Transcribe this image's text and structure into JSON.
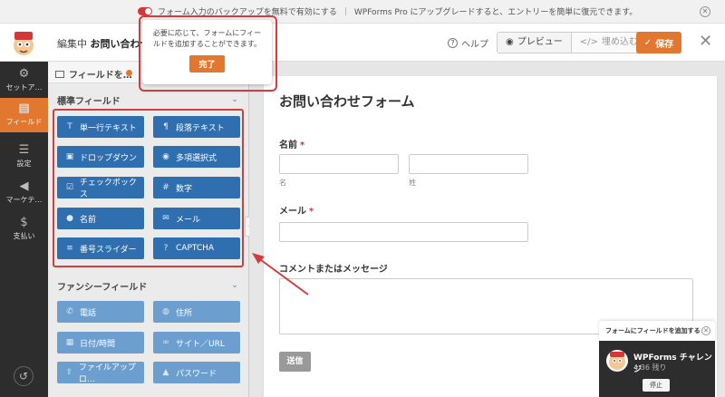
{
  "notice": {
    "text": "フォーム入力のバックアップを無料で有効にする",
    "upgrade": "WPForms Pro にアップグレードすると、エントリーを簡単に復元できます。"
  },
  "header": {
    "editing_prefix": "編集中",
    "form_name": "お問い合わせフォ",
    "help": "ヘルプ",
    "preview": "プレビュー",
    "embed": "埋め込む",
    "save": "保存"
  },
  "leftnav": [
    {
      "label": "セットア…",
      "icon": "gear-icon"
    },
    {
      "label": "フィールド",
      "icon": "fields-icon"
    },
    {
      "label": "設定",
      "icon": "sliders-icon"
    },
    {
      "label": "マーケテ…",
      "icon": "megaphone-icon"
    },
    {
      "label": "支払い",
      "icon": "dollar-icon"
    }
  ],
  "panel": {
    "tab_label": "フィールドを…",
    "standard_title": "標準フィールド",
    "fancy_title": "ファンシーフィールド",
    "standard_fields": [
      {
        "label": "単一行テキスト",
        "icon": "text-icon"
      },
      {
        "label": "段落テキスト",
        "icon": "paragraph-icon"
      },
      {
        "label": "ドロップダウン",
        "icon": "dropdown-icon"
      },
      {
        "label": "多項選択式",
        "icon": "radio-icon"
      },
      {
        "label": "チェックボックス",
        "icon": "checkbox-icon"
      },
      {
        "label": "数字",
        "icon": "hash-icon"
      },
      {
        "label": "名前",
        "icon": "user-icon"
      },
      {
        "label": "メール",
        "icon": "envelope-icon"
      },
      {
        "label": "番号スライダー",
        "icon": "slider-icon"
      },
      {
        "label": "CAPTCHA",
        "icon": "question-icon"
      }
    ],
    "fancy_fields": [
      {
        "label": "電話",
        "icon": "phone-icon"
      },
      {
        "label": "住所",
        "icon": "map-pin-icon"
      },
      {
        "label": "日付/時間",
        "icon": "calendar-icon"
      },
      {
        "label": "サイト／URL",
        "icon": "link-icon"
      },
      {
        "label": "ファイルアップロ…",
        "icon": "upload-icon"
      },
      {
        "label": "パスワード",
        "icon": "lock-icon"
      }
    ]
  },
  "tooltip": {
    "text": "必要に応じて、フォームにフィールドを追加することができます。",
    "done": "完了"
  },
  "form": {
    "title": "お問い合わせフォーム",
    "name_label": "名前",
    "first_sub": "名",
    "last_sub": "姓",
    "email_label": "メール",
    "comment_label": "コメントまたはメッセージ",
    "submit": "送信"
  },
  "challenge": {
    "header": "フォームにフィールドを追加する",
    "title": "WPForms チャレンジ",
    "time": "4:36 残り",
    "stop": "停止"
  },
  "colors": {
    "accent": "#e27730",
    "field_button": "#2f6fb0",
    "fancy_button": "#6c9fd0",
    "highlight": "#d23d3d"
  }
}
